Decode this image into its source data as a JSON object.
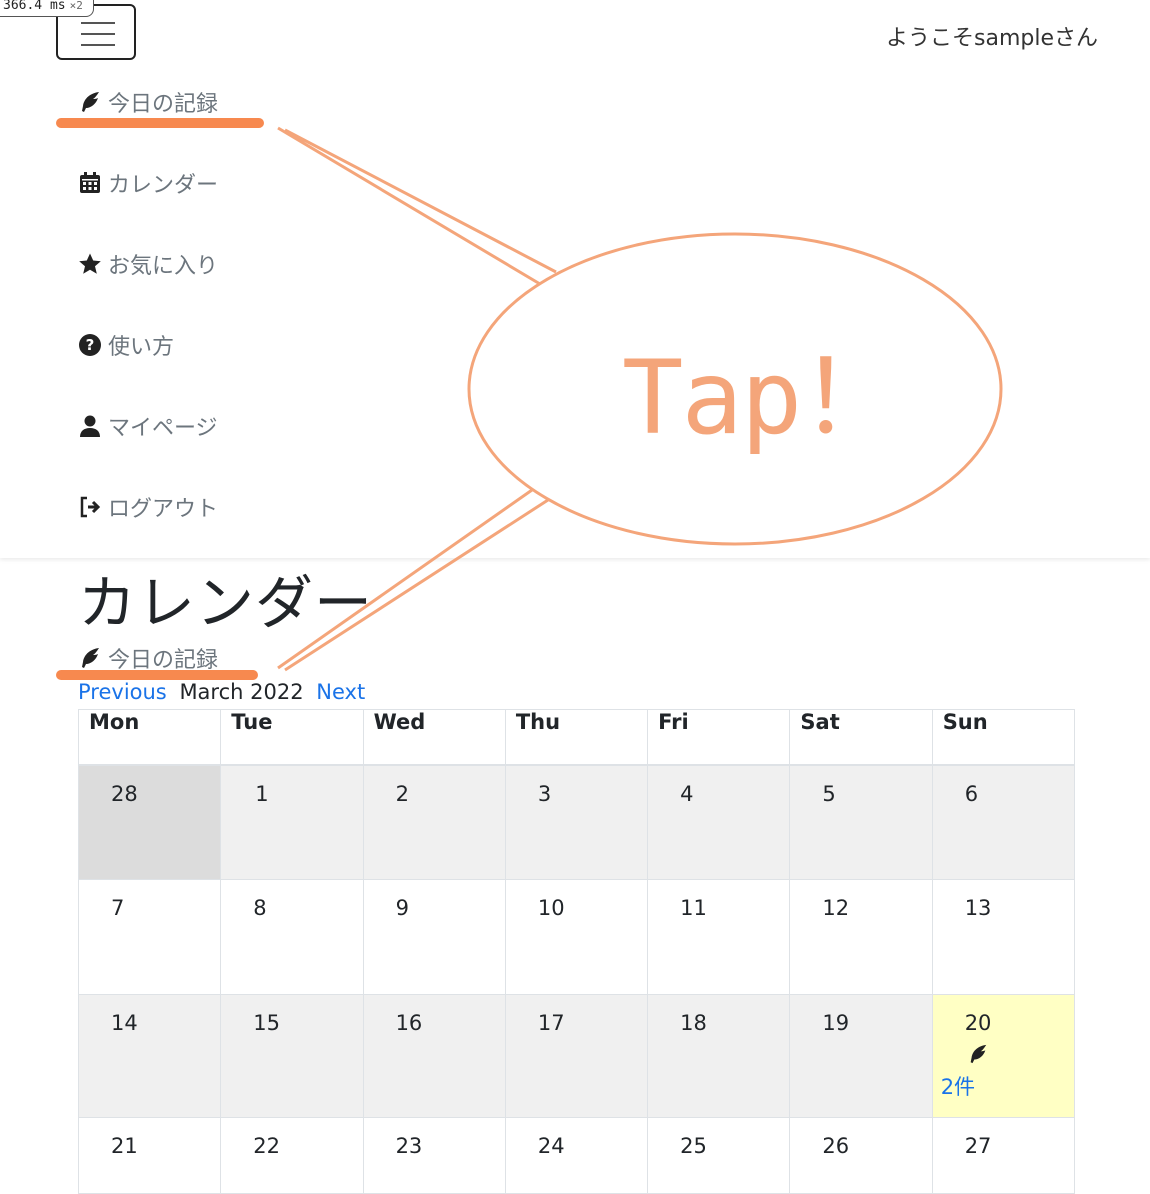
{
  "timing": {
    "value": "366.4 ms",
    "multiplier": "×2"
  },
  "header": {
    "welcome": "ようこそsampleさん"
  },
  "menu": {
    "items": [
      {
        "label": "今日の記録",
        "icon": "feather-icon"
      },
      {
        "label": "カレンダー",
        "icon": "calendar-icon"
      },
      {
        "label": "お気に入り",
        "icon": "star-icon"
      },
      {
        "label": "使い方",
        "icon": "question-circle-icon"
      },
      {
        "label": "マイページ",
        "icon": "user-icon"
      },
      {
        "label": "ログアウト",
        "icon": "sign-out-icon"
      }
    ]
  },
  "annotation": {
    "text": "Tap！",
    "color": "#f4a57a",
    "underline_color": "#f7894f"
  },
  "main": {
    "title": "カレンダー",
    "today_link": "今日の記録",
    "prev": "Previous",
    "month": "March 2022",
    "next": "Next"
  },
  "calendar": {
    "weekdays": [
      "Mon",
      "Tue",
      "Wed",
      "Thu",
      "Fri",
      "Sat",
      "Sun"
    ],
    "weeks": [
      [
        "28",
        "1",
        "2",
        "3",
        "4",
        "5",
        "6"
      ],
      [
        "7",
        "8",
        "9",
        "10",
        "11",
        "12",
        "13"
      ],
      [
        "14",
        "15",
        "16",
        "17",
        "18",
        "19",
        "20"
      ],
      [
        "21",
        "22",
        "23",
        "24",
        "25",
        "26",
        "27"
      ]
    ],
    "today_count": "2件",
    "colors": {
      "shade": "#f0f0f0",
      "other_month": "#dcdcdc",
      "today": "#ffffc4",
      "link": "#1a73e8"
    }
  }
}
